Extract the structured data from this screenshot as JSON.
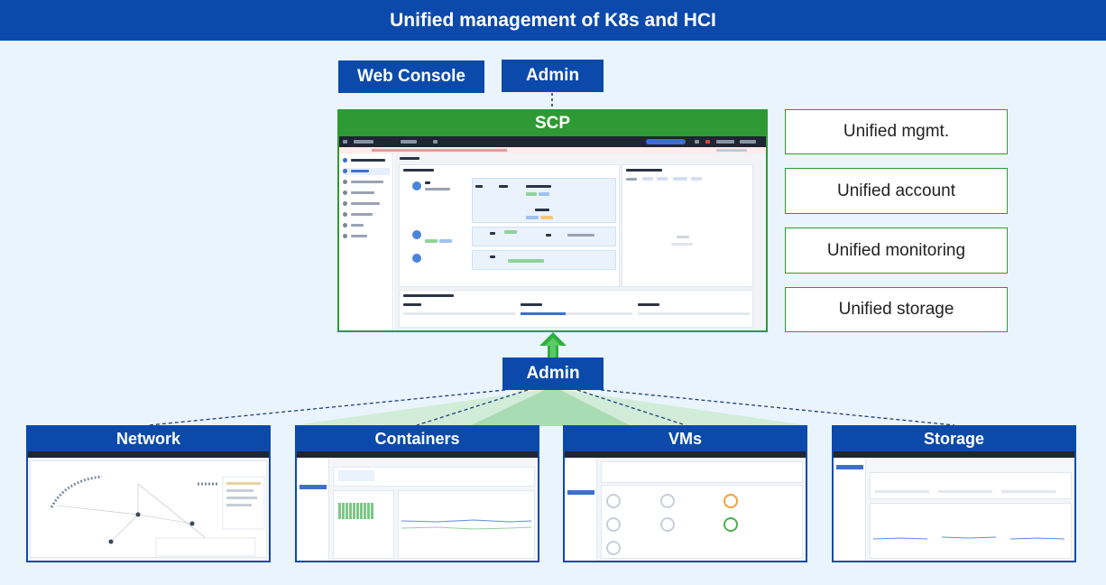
{
  "banner": {
    "title": "Unified management of K8s and HCI"
  },
  "top_buttons": {
    "web_console": "Web Console",
    "admin": "Admin"
  },
  "scp": {
    "title": "SCP"
  },
  "features": [
    "Unified mgmt.",
    "Unified account",
    "Unified monitoring",
    "Unified storage"
  ],
  "middle_admin": "Admin",
  "modules": [
    {
      "title": "Network"
    },
    {
      "title": "Containers"
    },
    {
      "title": "VMs"
    },
    {
      "title": "Storage"
    }
  ],
  "colors": {
    "blue": "#0b4aab",
    "green": "#2f9a34",
    "background": "#eaf4fd"
  }
}
